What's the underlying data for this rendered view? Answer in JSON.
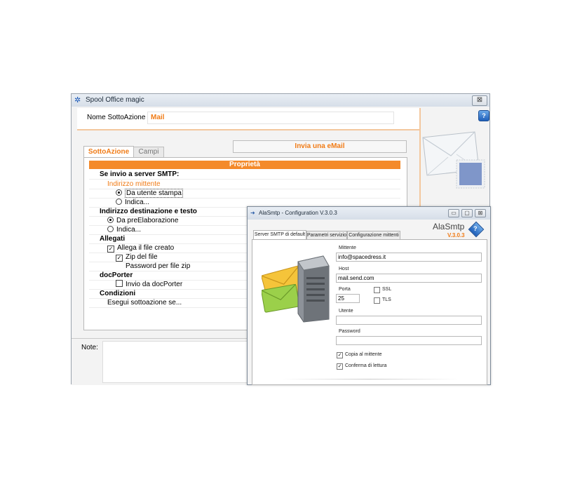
{
  "main_window": {
    "title": "Spool Office magic",
    "close_glyph": "⊠",
    "help_glyph": "?",
    "nome_label": "Nome SottoAzione",
    "nome_value": "Mail",
    "invia_label": "Invia una eMail",
    "tabs": [
      {
        "label": "SottoAzione",
        "active": true
      },
      {
        "label": "Campi",
        "active": false
      }
    ],
    "properties_header": "Proprietà",
    "rows": {
      "cat_smtp": "Se invio a server SMTP:",
      "indirizzo_mittente": "Indirizzo mittente",
      "da_utente_stampa": "Da utente stampa",
      "indica_1": "Indica...",
      "cat_destinazione": "Indirizzo destinazione e testo",
      "da_preelaborazione": "Da preElaborazione",
      "indica_2": "Indica...",
      "cat_allegati": "Allegati",
      "allega_file": "Allega il file creato",
      "zip_file": "Zip del file",
      "password_zip": "Password per file zip",
      "cat_docporter": "docPorter",
      "invio_docporter": "Invio da docPorter",
      "cat_condizioni": "Condizioni",
      "esegui_se": "Esegui sottoazione se..."
    },
    "notes_label": "Note:"
  },
  "smtp_dialog": {
    "title": "AlaSmtp - Configuration V.3.0.3",
    "brand": "AlaSmtp",
    "version": "V.3.0.3",
    "help_glyph": "?",
    "min_glyph": "▭",
    "max_glyph": "▢",
    "close_glyph": "⊠",
    "tabs": [
      {
        "label": "Server SMTP di default",
        "active": true
      },
      {
        "label": "Parametri servizio",
        "active": false
      },
      {
        "label": "Configurazione mittenti",
        "active": false
      }
    ],
    "fields": {
      "mittente_label": "Mittente",
      "mittente_value": "info@spacedress.it",
      "host_label": "Host",
      "host_value": "mail.send.com",
      "porta_label": "Porta",
      "porta_value": "25",
      "ssl_label": "SSL",
      "tls_label": "TLS",
      "utente_label": "Utente",
      "utente_value": "",
      "password_label": "Password",
      "password_value": "",
      "copia_label": "Copia al mittente",
      "conferma_label": "Conferma di lettura"
    },
    "checks": {
      "ssl": false,
      "tls": false,
      "copia": true,
      "conferma": true
    }
  },
  "colors": {
    "accent_orange": "#f07b16",
    "header_orange": "#f48a2a",
    "band_peach": "#f3c79e"
  },
  "icons": {
    "main_app": "spool-office-logo-icon",
    "envelope": "envelope-stamp-icon",
    "server": "server-envelope-icon"
  }
}
